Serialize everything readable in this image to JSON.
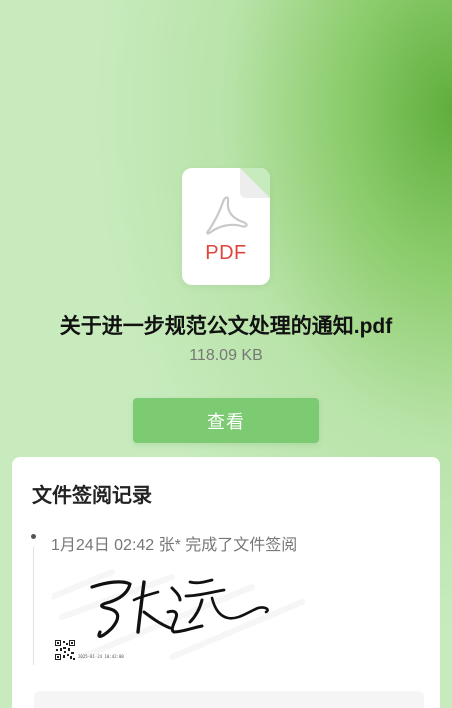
{
  "file": {
    "type_label": "PDF",
    "icon": "pdf-file-icon",
    "name": "关于进一步规范公文处理的通知.pdf",
    "size": "118.09 KB"
  },
  "actions": {
    "view_label": "查看"
  },
  "records": {
    "title": "文件签阅记录",
    "items": [
      {
        "text": "1月24日 02:42  张* 完成了文件签阅",
        "signature": "handwritten-signature",
        "signature_timestamp": "2025-01-24 10:42:00"
      }
    ]
  },
  "colors": {
    "accent_green": "#7ccb72",
    "pdf_red": "#e0453d"
  }
}
